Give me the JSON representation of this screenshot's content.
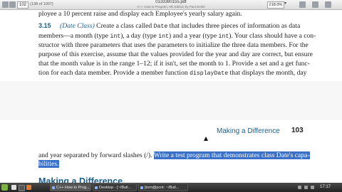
{
  "viewer": {
    "page_field": "102",
    "page_count": "(138 of 1007)",
    "title": "0133380155.pdf",
    "subtitle": "C++ How to Program, 9th Edition by Paul Deitel",
    "zoom": "218.0%"
  },
  "page": {
    "line0": "ployee a 10 percent raise and display each Employee's yearly salary again.",
    "ex_number": "3.15",
    "ex_lead": "(Date Class)",
    "line1_pre": " Create a class called ",
    "code_date": "Date",
    "line1_post": " that includes three pieces of information as data",
    "line2_a": "members—a month (type ",
    "code_int": "int",
    "line2_b": "), a day (type ",
    "line2_c": ") and a year (type ",
    "line2_d": "). Your class should have a con-",
    "line3": "structor with three parameters that uses the parameters to initialize the three data members. For the",
    "line4": "purpose of this exercise, assume that the values provided for the year and day are correct, but ensure",
    "line5": "that the month value is in the range 1–12; if it isn't, set the month to 1. Provide a set and a get func-",
    "line6_pre": "tion for each data member. Provide a member function ",
    "code_display": "displayDate",
    "line6_post": " that displays the month, day",
    "running_head": "Making a Difference",
    "page_number": "103",
    "line7_plain": "and year separated by forward slashes (/). ",
    "line7_hl": "Write a test program that demonstrates class Date's capa-",
    "line8_hl": "bilities.",
    "section_title": "Making a Difference"
  },
  "taskbar": {
    "tasks": [
      "C++ How to Prog...",
      "Desktop - [~/Buil...",
      "[tom@pcnt: ~/Buil..."
    ],
    "clock": "17:17"
  },
  "colors": {
    "accent": "#1a5f8a",
    "selection": "#3a70c8"
  }
}
